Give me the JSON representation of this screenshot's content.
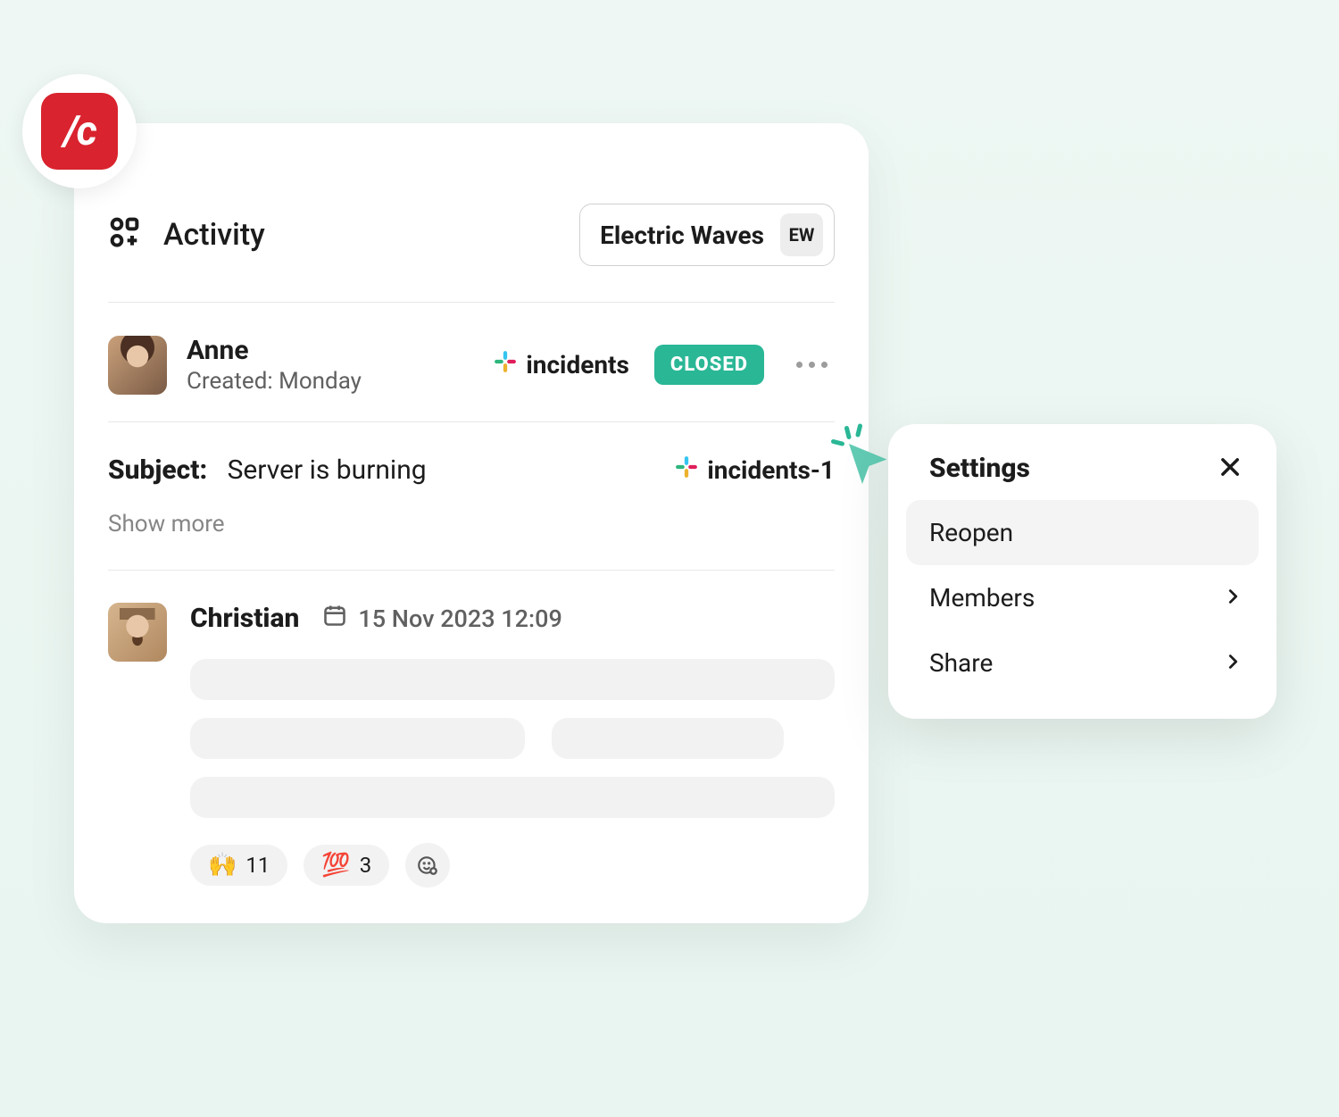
{
  "logo": {
    "text": "/c",
    "bg": "#d9232e"
  },
  "header": {
    "title": "Activity",
    "workspace": {
      "name": "Electric Waves",
      "initials": "EW"
    }
  },
  "item": {
    "author": {
      "name": "Anne",
      "created_prefix": "Created:",
      "created_value": "Monday"
    },
    "channel": "incidents",
    "status": "CLOSED",
    "subject_label": "Subject:",
    "subject_value": "Server is burning",
    "sub_channel": "incidents-1",
    "show_more": "Show more"
  },
  "comment": {
    "author": "Christian",
    "date": "15 Nov 2023 12:09",
    "reactions": [
      {
        "emoji": "🙌",
        "count": "11"
      },
      {
        "emoji": "💯",
        "count": "3"
      }
    ]
  },
  "popover": {
    "title": "Settings",
    "items": [
      {
        "label": "Reopen",
        "chevron": false,
        "highlight": true
      },
      {
        "label": "Members",
        "chevron": true,
        "highlight": false
      },
      {
        "label": "Share",
        "chevron": true,
        "highlight": false
      }
    ]
  }
}
